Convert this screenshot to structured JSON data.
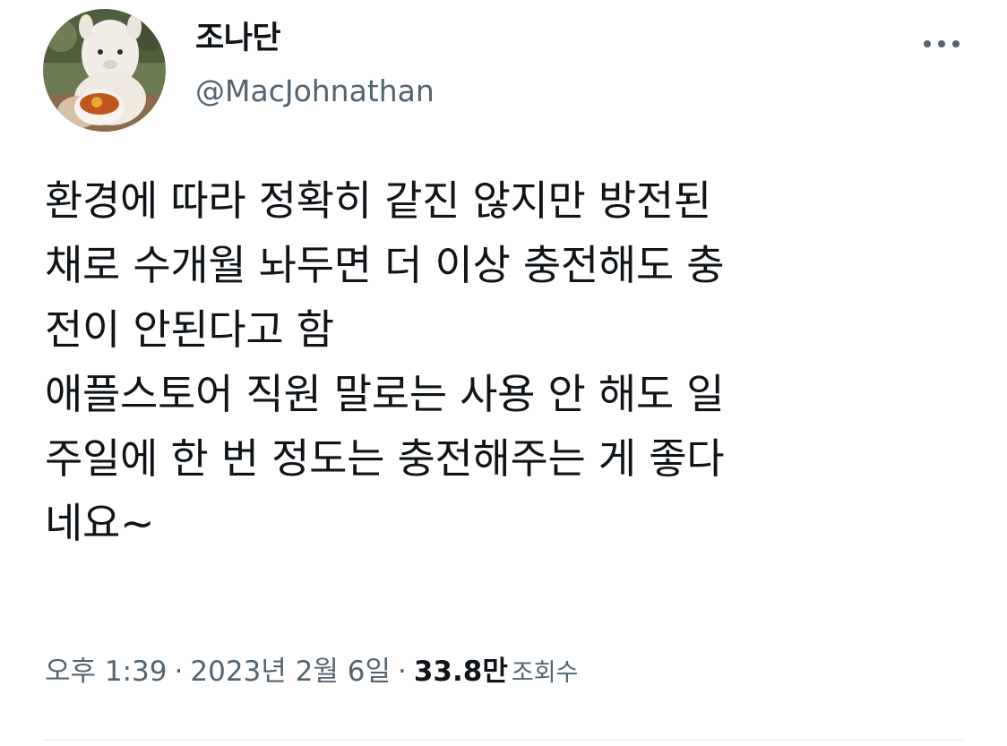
{
  "author": {
    "display_name": "조나단",
    "handle": "@MacJohnathan",
    "avatar_icon": "alpaca-plush-with-tea-avatar"
  },
  "menu": {
    "icon": "more-horizontal-icon"
  },
  "tweet": {
    "text": "환경에 따라 정확히 같진 않지만 방전된\n채로 수개월 놔두면 더 이상 충전해도 충\n전이 안된다고 함\n애플스토어 직원 말로는 사용 안 해도 일\n주일에 한 번 정도는 충전해주는 게 좋다\n네요~"
  },
  "meta": {
    "time": "오후 1:39",
    "separator": "·",
    "date": "2023년 2월 6일",
    "views_count": "33.8만",
    "views_label": "조회수"
  },
  "colors": {
    "text_primary": "#0f1419",
    "text_secondary": "#536471",
    "divider": "#e7e9ea"
  }
}
